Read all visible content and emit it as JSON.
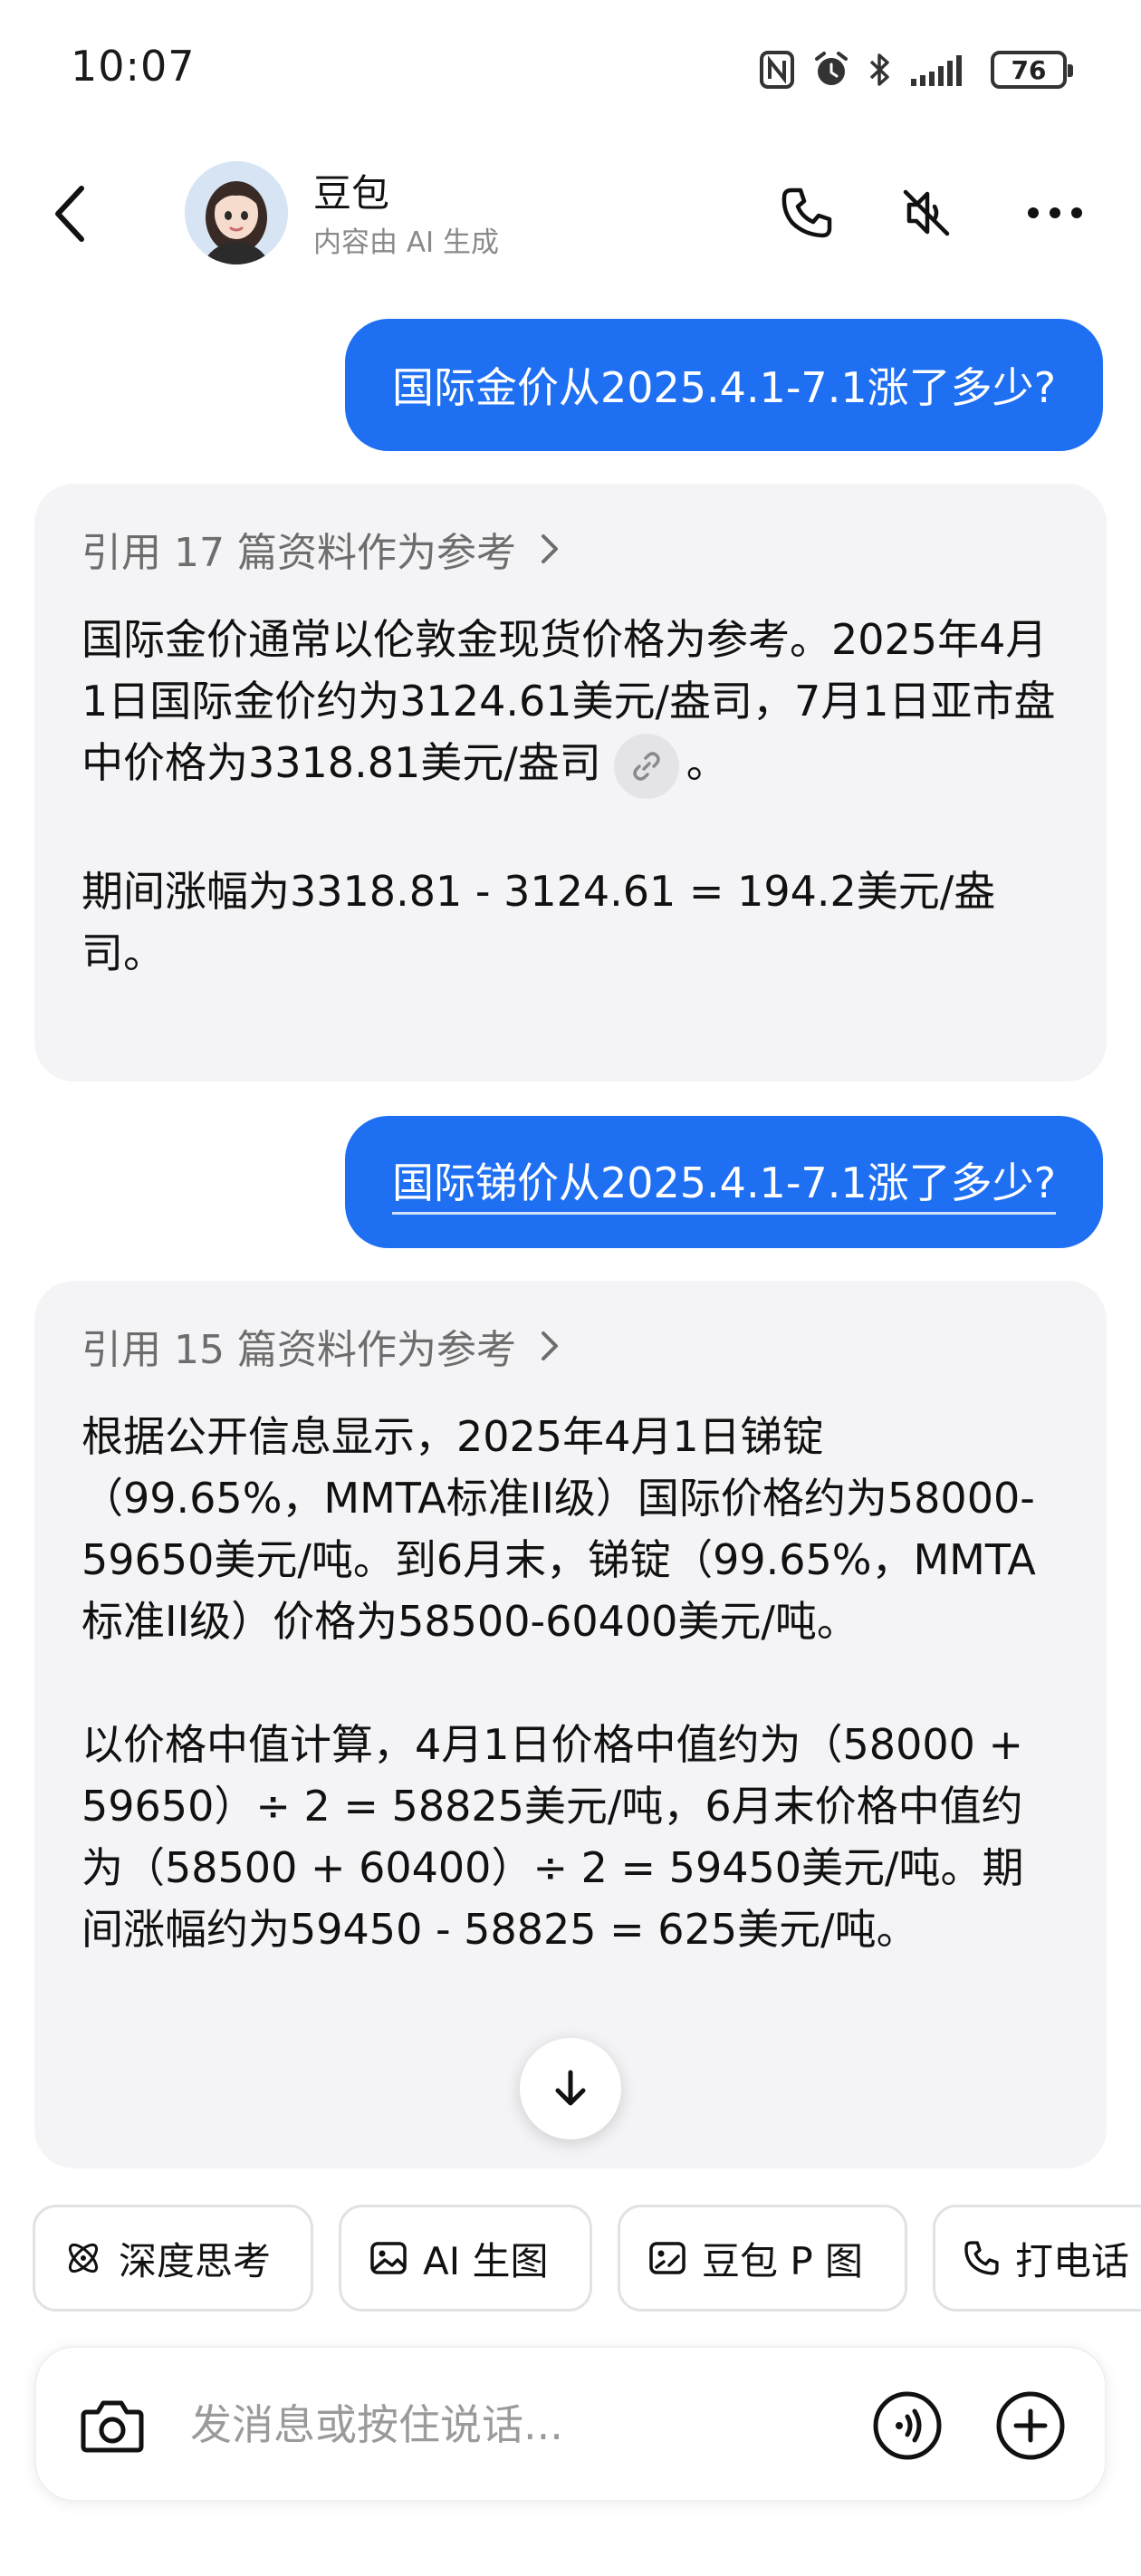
{
  "status_bar": {
    "time": "10:07",
    "battery": "76"
  },
  "header": {
    "bot_name": "豆包",
    "subtitle": "内容由 AI 生成"
  },
  "messages": [
    {
      "role": "user",
      "text": "国际金价从2025.4.1-7.1涨了多少?"
    },
    {
      "role": "bot",
      "ref_label": "引用 17 篇资料作为参考",
      "para1": "国际金价通常以伦敦金现货价格为参考。2025年4月1日国际金价约为3124.61美元/盎司，7月1日亚市盘中价格为3318.81美元/盎司",
      "para1_end": "。",
      "para2": "期间涨幅为3318.81 - 3124.61 = 194.2美元/盎司。"
    },
    {
      "role": "user",
      "text": "国际锑价从2025.4.1-7.1涨了多少?"
    },
    {
      "role": "bot",
      "ref_label": "引用 15 篇资料作为参考",
      "para1": "根据公开信息显示，2025年4月1日锑锭（99.65%，MMTA标准II级）国际价格约为58000-59650美元/吨。到6月末，锑锭（99.65%，MMTA标准II级）价格为58500-60400美元/吨。",
      "para2": "以价格中值计算，4月1日价格中值约为（58000 + 59650）÷ 2 = 58825美元/吨，6月末价格中值约为（58500 + 60400）÷ 2 = 59450美元/吨。期间涨幅约为59450 - 58825 = 625美元/吨。"
    }
  ],
  "quick_actions": [
    {
      "label": "深度思考",
      "icon": "atom-icon"
    },
    {
      "label": "AI 生图",
      "icon": "image-icon"
    },
    {
      "label": "豆包 P 图",
      "icon": "photo-edit-icon"
    },
    {
      "label": "打电话",
      "icon": "phone-icon"
    }
  ],
  "input": {
    "placeholder": "发消息或按住说话..."
  },
  "colors": {
    "user_bubble": "#1f6ff2",
    "bot_bubble": "#f4f4f6",
    "accent": "#1f6ff2"
  }
}
